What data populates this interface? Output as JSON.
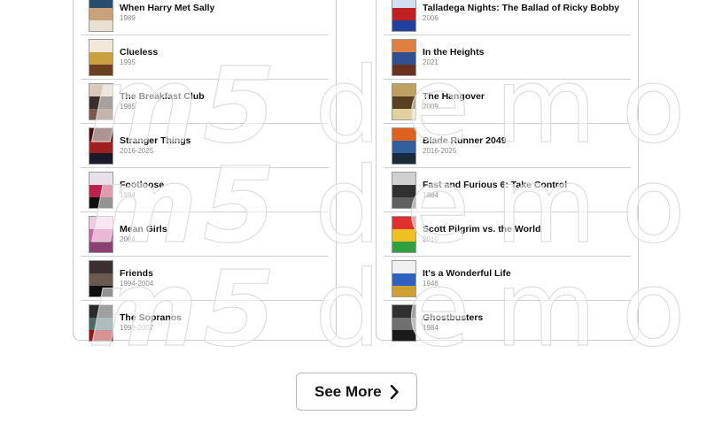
{
  "left_list": {
    "items": [
      {
        "title": "When Harry Met Sally",
        "year": "1989",
        "poster_colors": [
          "#2a4d6e",
          "#c9a27a",
          "#e8e0d0"
        ]
      },
      {
        "title": "Clueless",
        "year": "1995",
        "poster_colors": [
          "#f2e8d8",
          "#c8a040",
          "#6a4020"
        ]
      },
      {
        "title": "The Breakfast Club",
        "year": "1985",
        "poster_colors": [
          "#d9c9b6",
          "#3a2e2a",
          "#7a5a4a"
        ]
      },
      {
        "title": "Stranger Things",
        "year": "2016-2025",
        "poster_colors": [
          "#4a1010",
          "#a02020",
          "#1a1a2a"
        ]
      },
      {
        "title": "Footloose",
        "year": "1984",
        "poster_colors": [
          "#e8e0e8",
          "#c02050",
          "#101010"
        ]
      },
      {
        "title": "Mean Girls",
        "year": "2004",
        "poster_colors": [
          "#f0c8e0",
          "#d060a0",
          "#8a4070"
        ]
      },
      {
        "title": "Friends",
        "year": "1994-2004",
        "poster_colors": [
          "#3a3030",
          "#6a5a50",
          "#101010"
        ]
      },
      {
        "title": "The Sopranos",
        "year": "1999-2007",
        "poster_colors": [
          "#2a2a2a",
          "#4a6a6a",
          "#a01010"
        ]
      }
    ]
  },
  "right_list": {
    "items": [
      {
        "title": "Talladega Nights: The Ballad of Ricky Bobby",
        "year": "2006",
        "poster_colors": [
          "#d0e0f0",
          "#c02020",
          "#2040a0"
        ]
      },
      {
        "title": "In the Heights",
        "year": "2021",
        "poster_colors": [
          "#e08040",
          "#305090",
          "#6a3020"
        ]
      },
      {
        "title": "The Hangover",
        "year": "2009",
        "poster_colors": [
          "#c0a060",
          "#5a4020",
          "#e0d0a0"
        ]
      },
      {
        "title": "Blade Runner 2049",
        "year": "2016-2025",
        "poster_colors": [
          "#e06020",
          "#3060a0",
          "#1a2a3a"
        ]
      },
      {
        "title": "Fast and Furious 6: Take Control",
        "year": "1984",
        "poster_colors": [
          "#d0d0d0",
          "#303030",
          "#606060"
        ]
      },
      {
        "title": "Scott Pilgrim vs. the World",
        "year": "2010",
        "poster_colors": [
          "#e03030",
          "#f0c020",
          "#30a040"
        ]
      },
      {
        "title": "It's a Wonderful Life",
        "year": "1946",
        "poster_colors": [
          "#f0f0f0",
          "#3060c0",
          "#d0a030"
        ]
      },
      {
        "title": "Ghostbusters",
        "year": "1984",
        "poster_colors": [
          "#303030",
          "#707070",
          "#1a1a1a"
        ]
      }
    ]
  },
  "watermark": {
    "bold": "m5",
    "light": "demo"
  },
  "see_more": {
    "label": "See More",
    "icon": "chevron-right-icon"
  }
}
